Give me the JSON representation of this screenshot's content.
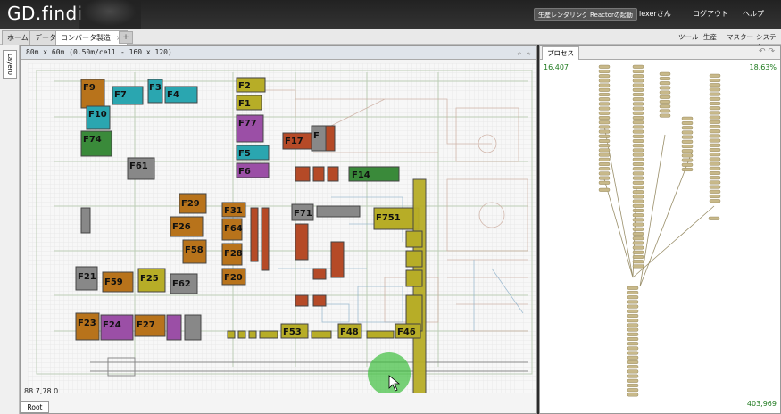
{
  "header": {
    "logo": "GD.findi",
    "btn_rendering": "生産レンダリング",
    "btn_reactor": "Reactorの起動",
    "user": "lexerさん",
    "separator": "|",
    "logout": "ログアウト",
    "help": "ヘルプ"
  },
  "tabs": [
    {
      "label": "ホーム"
    },
    {
      "label": "データ"
    },
    {
      "label": "コンバータ製造"
    }
  ],
  "tab_close": "×",
  "new_tab": "+",
  "menu": {
    "tool": "ツール",
    "production": "生産",
    "master": "マスター",
    "system": "システム"
  },
  "layer_tab": "Layer0",
  "map": {
    "title": "80m x 60m (0.50m/cell - 160 x 120)",
    "coord": "88.7,78.0",
    "root": "Root",
    "blocks": [
      {
        "label": "F9",
        "color": "#b8731b"
      },
      {
        "label": "F7",
        "color": "#2aa6b0"
      },
      {
        "label": "F3",
        "color": "#2aa6b0"
      },
      {
        "label": "F4",
        "color": "#2aa6b0"
      },
      {
        "label": "F10",
        "color": "#2aa6b0"
      },
      {
        "label": "F74",
        "color": "#3a8a3a"
      },
      {
        "label": "F61",
        "color": "#888888"
      },
      {
        "label": "F2",
        "color": "#b7ad27"
      },
      {
        "label": "F1",
        "color": "#b7ad27"
      },
      {
        "label": "F77",
        "color": "#9b4fa6"
      },
      {
        "label": "F5",
        "color": "#2aa6b0"
      },
      {
        "label": "F6",
        "color": "#9b4fa6"
      },
      {
        "label": "F17",
        "color": "#b54a27"
      },
      {
        "label": "F",
        "color": "#888888"
      },
      {
        "label": "F14",
        "color": "#3a8a3a"
      },
      {
        "label": "F29",
        "color": "#b8731b"
      },
      {
        "label": "F26",
        "color": "#b8731b"
      },
      {
        "label": "F58",
        "color": "#b8731b"
      },
      {
        "label": "F31",
        "color": "#b8731b"
      },
      {
        "label": "F64",
        "color": "#b8731b"
      },
      {
        "label": "F28",
        "color": "#b8731b"
      },
      {
        "label": "F20",
        "color": "#b8731b"
      },
      {
        "label": "F71",
        "color": "#888888"
      },
      {
        "label": "F751",
        "color": "#b7ad27"
      },
      {
        "label": "F21",
        "color": "#888888"
      },
      {
        "label": "F59",
        "color": "#b8731b"
      },
      {
        "label": "F25",
        "color": "#b7ad27"
      },
      {
        "label": "F62",
        "color": "#888888"
      },
      {
        "label": "F23",
        "color": "#b8731b"
      },
      {
        "label": "F24",
        "color": "#9b4fa6"
      },
      {
        "label": "F27",
        "color": "#b8731b"
      },
      {
        "label": "F53",
        "color": "#b7ad27"
      },
      {
        "label": "F48",
        "color": "#b7ad27"
      },
      {
        "label": "F46",
        "color": "#b7ad27"
      }
    ]
  },
  "process": {
    "tab": "プロセス",
    "top_left": "16,407",
    "top_right": "18.63%",
    "bottom_right": "403,969"
  },
  "colors": {
    "accent_green": "#1e7a1e",
    "header_bg": "#2b2b2b"
  }
}
